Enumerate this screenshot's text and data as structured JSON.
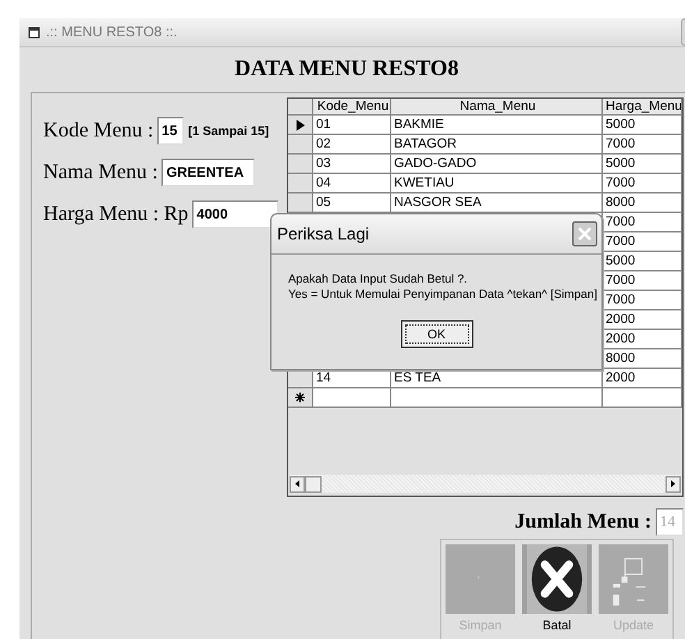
{
  "window": {
    "title": ".:: MENU RESTO8 ::."
  },
  "heading": "DATA MENU RESTO8",
  "form": {
    "fields": [
      {
        "label": "Kode Menu :",
        "value": "15",
        "hint": "[1 Sampai 15]"
      },
      {
        "label": "Nama Menu :",
        "value": "GREENTEA"
      },
      {
        "label": "Harga Menu : Rp",
        "value": "4000"
      }
    ]
  },
  "table": {
    "columns": [
      "Kode_Menu",
      "Nama_Menu",
      "Harga_Menu"
    ],
    "rows": [
      {
        "current": true,
        "cells": [
          "01",
          "BAKMIE",
          "5000"
        ]
      },
      {
        "current": false,
        "cells": [
          "02",
          "BATAGOR",
          "7000"
        ]
      },
      {
        "current": false,
        "cells": [
          "03",
          "GADO-GADO",
          "5000"
        ]
      },
      {
        "current": false,
        "cells": [
          "04",
          "KWETIAU",
          "7000"
        ]
      },
      {
        "current": false,
        "cells": [
          "05",
          "NASGOR SEA",
          "8000"
        ]
      },
      {
        "cells": [
          "",
          "",
          "7000"
        ]
      },
      {
        "cells": [
          "",
          "",
          "7000"
        ]
      },
      {
        "cells": [
          "",
          "",
          "5000"
        ]
      },
      {
        "cells": [
          "",
          "",
          "7000"
        ]
      },
      {
        "cells": [
          "",
          "",
          "7000"
        ]
      },
      {
        "cells": [
          "",
          "",
          "2000"
        ]
      },
      {
        "cells": [
          "",
          "",
          "2000"
        ]
      },
      {
        "cells": [
          "",
          "",
          "8000"
        ]
      },
      {
        "current": false,
        "cells": [
          "14",
          "ES TEA",
          "2000"
        ]
      }
    ]
  },
  "count": {
    "label": "Jumlah Menu :",
    "value": "14",
    "disabled": true
  },
  "buttons": [
    {
      "kind": "save",
      "label": "Simpan",
      "disabled": true
    },
    {
      "kind": "cancel",
      "label": "Batal",
      "disabled": false
    },
    {
      "kind": "update",
      "label": "Update",
      "disabled": true
    }
  ],
  "dialog": {
    "title": "Periksa Lagi",
    "lines": [
      "Apakah Data Input Sudah Betul ?.",
      "Yes = Untuk Memulai Penyimpanan Data ^tekan^ [Simpan]"
    ],
    "button": "OK"
  }
}
